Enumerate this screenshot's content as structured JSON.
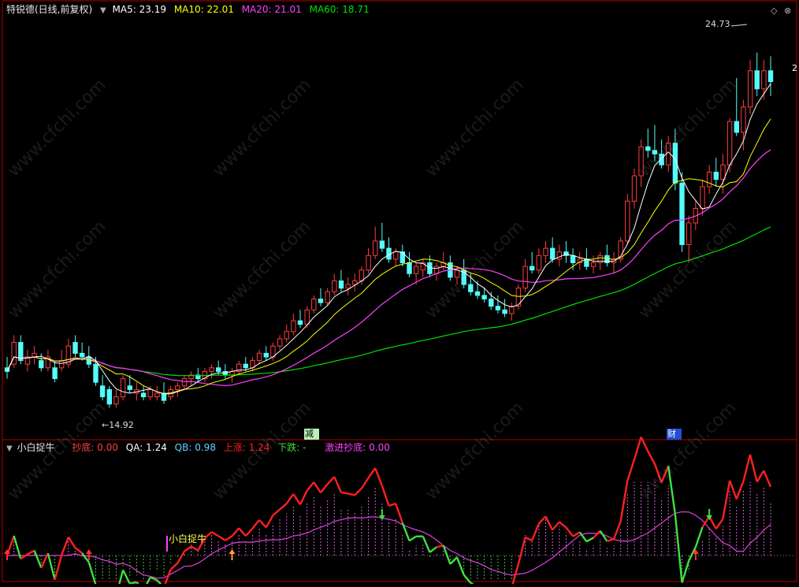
{
  "header": {
    "stock": "特锐德(日线,前复权)",
    "ma5_label": "MA5:",
    "ma5_value": "23.19",
    "ma10_label": "MA10:",
    "ma10_value": "22.01",
    "ma20_label": "MA20:",
    "ma20_value": "21.01",
    "ma60_label": "MA60:",
    "ma60_value": "18.71"
  },
  "indicator": {
    "name": "小白捉牛",
    "chaodi_label": "抄底:",
    "chaodi_value": "0.00",
    "qa_label": "QA:",
    "qa_value": "1.24",
    "qb_label": "QB:",
    "qb_value": "0.98",
    "up_label": "上涨:",
    "up_value": "1.24",
    "down_label": "下跌:",
    "down_value": "-",
    "aggr_label": "激进抄底:",
    "aggr_value": "0.00",
    "signal_text": "小白捉牛"
  },
  "annotations": {
    "high_label": "24.73",
    "low_label": "14.92",
    "marker1": "减",
    "marker2": "财",
    "right_edge": "2"
  },
  "watermark": "www.cfchi.com",
  "colors": {
    "up": "#ff3c3c",
    "down": "#54fcfc",
    "ma5": "#ffffff",
    "ma10": "#ffff00",
    "ma20": "#ff40ff",
    "ma60": "#00e000",
    "axis": "#b00000",
    "qa_up": "#ff2020",
    "qa_down": "#40e040",
    "qb": "#60d0ff",
    "qb2": "#e040e0"
  },
  "chart_data": {
    "type": "candlestick",
    "title": "特锐德(日线,前复权)",
    "xlabel": "",
    "ylabel": "",
    "ylim": [
      14.3,
      25.5
    ],
    "ohlc": [
      [
        16.0,
        16.3,
        15.7,
        15.9
      ],
      [
        16.1,
        16.9,
        16.0,
        16.7
      ],
      [
        16.7,
        16.9,
        16.1,
        16.2
      ],
      [
        16.1,
        16.5,
        15.9,
        16.3
      ],
      [
        16.3,
        16.6,
        16.1,
        16.4
      ],
      [
        16.2,
        16.4,
        15.9,
        16.0
      ],
      [
        16.0,
        16.5,
        15.9,
        16.3
      ],
      [
        16.0,
        16.2,
        15.6,
        15.7
      ],
      [
        16.0,
        16.5,
        15.9,
        16.2
      ],
      [
        16.1,
        16.8,
        16.0,
        16.6
      ],
      [
        16.7,
        16.9,
        16.3,
        16.4
      ],
      [
        16.4,
        16.7,
        16.2,
        16.3
      ],
      [
        16.3,
        16.6,
        16.0,
        16.1
      ],
      [
        16.1,
        16.3,
        15.5,
        15.6
      ],
      [
        15.5,
        15.8,
        15.1,
        15.2
      ],
      [
        15.4,
        15.5,
        14.9,
        15.0
      ],
      [
        15.0,
        15.4,
        14.9,
        15.2
      ],
      [
        15.2,
        15.8,
        15.1,
        15.7
      ],
      [
        15.5,
        15.8,
        15.3,
        15.4
      ],
      [
        15.3,
        15.6,
        15.1,
        15.4
      ],
      [
        15.3,
        15.5,
        15.1,
        15.2
      ],
      [
        15.2,
        15.5,
        15.1,
        15.4
      ],
      [
        15.2,
        15.5,
        15.1,
        15.3
      ],
      [
        15.3,
        15.6,
        15.0,
        15.1
      ],
      [
        15.2,
        15.5,
        15.1,
        15.4
      ],
      [
        15.4,
        15.6,
        15.2,
        15.5
      ],
      [
        15.5,
        15.8,
        15.4,
        15.7
      ],
      [
        15.7,
        15.9,
        15.5,
        15.8
      ],
      [
        15.8,
        16.0,
        15.6,
        15.7
      ],
      [
        15.7,
        16.0,
        15.6,
        15.9
      ],
      [
        15.9,
        16.1,
        15.7,
        16.0
      ],
      [
        16.0,
        16.2,
        15.8,
        15.9
      ],
      [
        15.9,
        16.1,
        15.7,
        15.8
      ],
      [
        15.8,
        16.0,
        15.6,
        15.9
      ],
      [
        15.9,
        16.2,
        15.8,
        16.1
      ],
      [
        16.1,
        16.3,
        15.9,
        16.0
      ],
      [
        16.0,
        16.3,
        15.9,
        16.2
      ],
      [
        16.2,
        16.5,
        16.1,
        16.4
      ],
      [
        16.4,
        16.6,
        16.2,
        16.3
      ],
      [
        16.3,
        16.7,
        16.2,
        16.6
      ],
      [
        16.6,
        16.9,
        16.5,
        16.8
      ],
      [
        16.8,
        17.2,
        16.7,
        17.0
      ],
      [
        17.0,
        17.5,
        16.9,
        17.3
      ],
      [
        17.3,
        17.6,
        17.1,
        17.2
      ],
      [
        17.2,
        17.7,
        17.1,
        17.6
      ],
      [
        17.6,
        18.0,
        17.5,
        17.9
      ],
      [
        17.9,
        18.2,
        17.7,
        17.8
      ],
      [
        17.8,
        18.2,
        17.7,
        18.1
      ],
      [
        18.1,
        18.6,
        18.0,
        18.4
      ],
      [
        18.4,
        18.7,
        18.1,
        18.2
      ],
      [
        18.2,
        18.5,
        18.0,
        18.3
      ],
      [
        18.3,
        18.6,
        18.1,
        18.4
      ],
      [
        18.4,
        18.8,
        18.3,
        18.7
      ],
      [
        18.7,
        19.3,
        18.6,
        19.1
      ],
      [
        19.1,
        19.9,
        19.0,
        19.5
      ],
      [
        19.5,
        20.0,
        19.2,
        19.3
      ],
      [
        19.3,
        19.6,
        18.9,
        19.0
      ],
      [
        19.0,
        19.3,
        18.8,
        19.2
      ],
      [
        19.2,
        19.4,
        18.8,
        18.9
      ],
      [
        18.9,
        19.2,
        18.5,
        18.6
      ],
      [
        18.6,
        18.9,
        18.3,
        18.8
      ],
      [
        18.7,
        19.0,
        18.5,
        18.9
      ],
      [
        18.9,
        19.1,
        18.5,
        18.6
      ],
      [
        18.6,
        18.9,
        18.4,
        18.8
      ],
      [
        18.8,
        19.2,
        18.7,
        18.9
      ],
      [
        18.9,
        19.1,
        18.4,
        18.5
      ],
      [
        18.5,
        18.8,
        18.3,
        18.7
      ],
      [
        18.7,
        19.0,
        18.2,
        18.3
      ],
      [
        18.3,
        18.6,
        18.0,
        18.1
      ],
      [
        18.1,
        18.4,
        17.9,
        18.0
      ],
      [
        18.0,
        18.2,
        17.8,
        17.9
      ],
      [
        17.9,
        18.1,
        17.6,
        17.7
      ],
      [
        17.7,
        18.0,
        17.5,
        17.6
      ],
      [
        17.6,
        17.9,
        17.4,
        17.5
      ],
      [
        17.5,
        17.8,
        17.3,
        17.7
      ],
      [
        17.7,
        18.3,
        17.6,
        18.2
      ],
      [
        18.2,
        19.0,
        18.1,
        18.8
      ],
      [
        18.8,
        19.2,
        18.6,
        18.7
      ],
      [
        18.7,
        19.3,
        18.6,
        19.1
      ],
      [
        19.1,
        19.5,
        18.9,
        19.3
      ],
      [
        19.3,
        19.6,
        18.9,
        19.0
      ],
      [
        19.0,
        19.4,
        18.8,
        19.2
      ],
      [
        19.2,
        19.5,
        18.9,
        19.1
      ],
      [
        19.1,
        19.3,
        18.7,
        18.9
      ],
      [
        18.9,
        19.2,
        18.7,
        19.0
      ],
      [
        19.0,
        19.3,
        18.7,
        18.8
      ],
      [
        18.8,
        19.1,
        18.6,
        18.9
      ],
      [
        18.9,
        19.2,
        18.7,
        19.1
      ],
      [
        19.1,
        19.4,
        18.8,
        18.9
      ],
      [
        18.9,
        19.2,
        18.6,
        19.0
      ],
      [
        19.0,
        19.6,
        18.9,
        19.5
      ],
      [
        19.5,
        20.8,
        19.4,
        20.6
      ],
      [
        20.6,
        21.5,
        20.4,
        21.3
      ],
      [
        21.3,
        22.3,
        21.0,
        22.1
      ],
      [
        22.1,
        22.6,
        21.8,
        22.0
      ],
      [
        22.0,
        22.7,
        21.7,
        21.9
      ],
      [
        21.9,
        22.3,
        21.5,
        21.6
      ],
      [
        21.6,
        22.4,
        21.4,
        22.2
      ],
      [
        22.2,
        22.6,
        20.9,
        21.1
      ],
      [
        21.1,
        21.4,
        19.2,
        19.4
      ],
      [
        19.4,
        20.2,
        18.9,
        20.0
      ],
      [
        20.0,
        20.6,
        19.8,
        20.4
      ],
      [
        20.4,
        21.2,
        20.2,
        21.0
      ],
      [
        21.0,
        21.6,
        20.8,
        21.4
      ],
      [
        21.4,
        21.8,
        21.0,
        21.2
      ],
      [
        21.2,
        21.9,
        20.8,
        21.6
      ],
      [
        21.6,
        22.9,
        21.4,
        22.8
      ],
      [
        22.8,
        24.0,
        22.4,
        22.5
      ],
      [
        22.5,
        23.4,
        22.0,
        23.2
      ],
      [
        23.2,
        24.5,
        23.0,
        24.2
      ],
      [
        24.2,
        24.7,
        23.5,
        23.7
      ],
      [
        23.7,
        24.5,
        23.4,
        24.2
      ],
      [
        24.2,
        24.6,
        23.5,
        23.9
      ]
    ]
  }
}
